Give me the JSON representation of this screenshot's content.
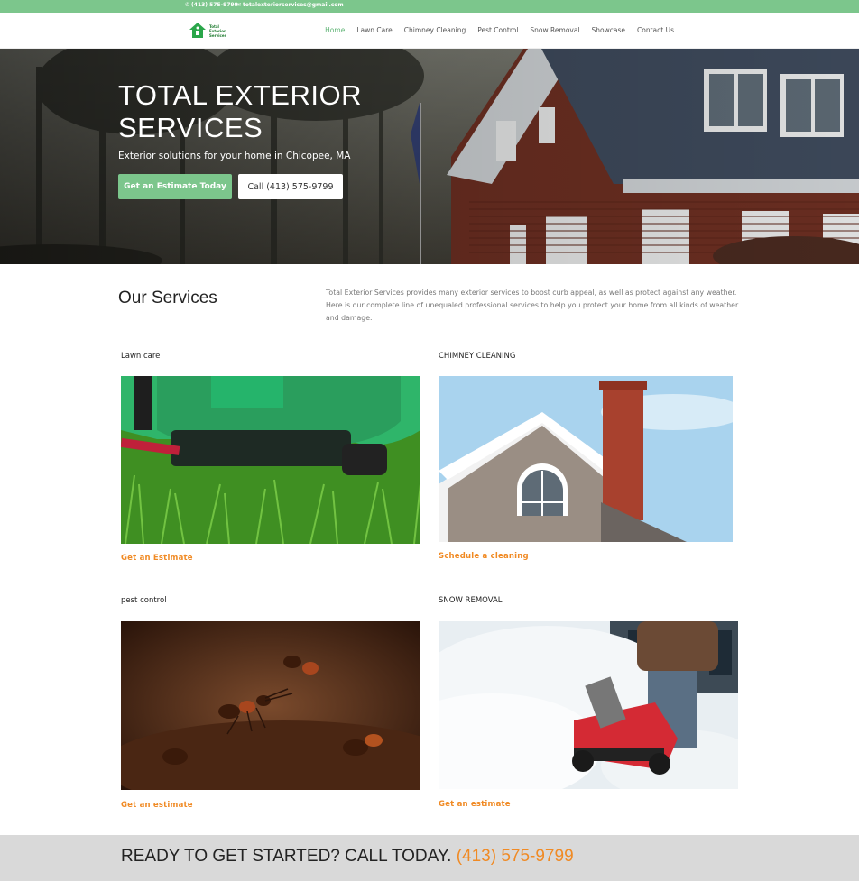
{
  "topbar": {
    "phone": "(413) 575-9799",
    "email": "totalexteriorservices@gmail.com",
    "phone_icon": "phone-icon",
    "email_icon": "envelope-icon",
    "color": "#7cc68c"
  },
  "logo": {
    "text": "Total Exterior Services",
    "color": "#2aa64a"
  },
  "nav": {
    "items": [
      {
        "label": "Home",
        "active": true
      },
      {
        "label": "Lawn Care"
      },
      {
        "label": "Chimney Cleaning"
      },
      {
        "label": "Pest Control"
      },
      {
        "label": "Snow Removal"
      },
      {
        "label": "Showcase"
      },
      {
        "label": "Contact Us"
      }
    ]
  },
  "hero": {
    "title_line1": "TOTAL EXTERIOR",
    "title_line2": "SERVICES",
    "subtitle": "Exterior solutions for your home in Chicopee, MA",
    "cta_primary": "Get an Estimate Today",
    "cta_secondary": "Call (413) 575-9799"
  },
  "services": {
    "title": "Our Services",
    "description": "Total Exterior Services provides many exterior services to boost curb appeal, as well as protect against any weather. Here is our complete line of unequaled professional services to help you protect your home from all kinds of weather and damage.",
    "cards": [
      {
        "title": "Lawn care",
        "link": "Get an Estimate"
      },
      {
        "title": "CHIMNEY CLEANING",
        "link": "Schedule a cleaning"
      },
      {
        "title": "pest control",
        "link": "Get an estimate"
      },
      {
        "title": "SNOW REMOVAL",
        "link": "Get an estimate"
      }
    ]
  },
  "cta": {
    "text": "READY TO GET STARTED? CALL TODAY.",
    "phone": "(413) 575-9799"
  },
  "colors": {
    "accent_green": "#7cc68c",
    "link_orange": "#f08a24",
    "cta_bg": "#d9d9d9"
  }
}
